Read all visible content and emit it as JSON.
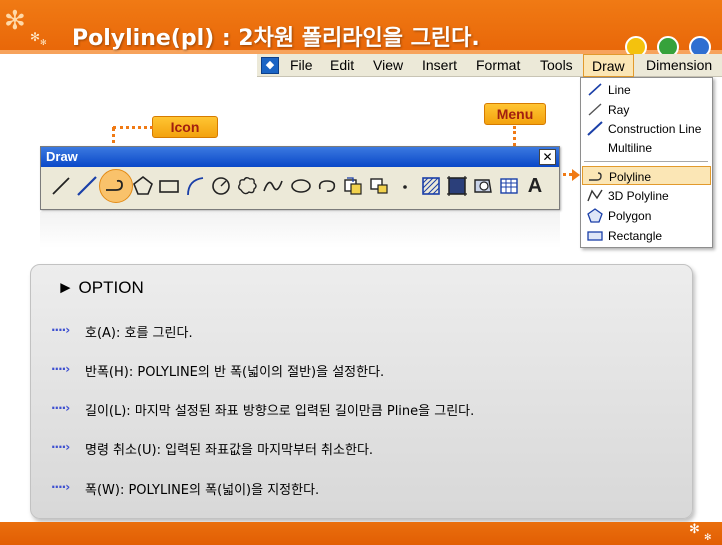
{
  "slide": {
    "title": "Polyline(pl) : 2차원 폴리라인을 그린다."
  },
  "menubar": {
    "items": [
      "File",
      "Edit",
      "View",
      "Insert",
      "Format",
      "Tools",
      "Draw",
      "Dimension"
    ],
    "active": "Draw"
  },
  "dropdown": {
    "items": [
      "Line",
      "Ray",
      "Construction Line",
      "Multiline",
      "Polyline",
      "3D Polyline",
      "Polygon",
      "Rectangle"
    ],
    "selected": "Polyline"
  },
  "callouts": {
    "icon_label": "Icon",
    "menu_label": "Menu"
  },
  "toolbar": {
    "title": "Draw",
    "close": "✕",
    "text_tool": "A",
    "highlighted_icon": "polyline-icon"
  },
  "options": {
    "heading": "► OPTION",
    "bullet": "····›",
    "rows": [
      "호(A): 호를 그린다.",
      "반폭(H): POLYLINE의 반 폭(넓이의 절반)을 설정한다.",
      "길이(L): 마지막 설정된 좌표 방향으로 입력된 길이만큼 Pline을 그린다.",
      "명령 취소(U): 입력된 좌표값을 마지막부터 취소한다.",
      "폭(W): POLYLINE의 폭(넓이)을 지정한다."
    ]
  },
  "colors": {
    "accent": "#f07a14",
    "bullet": "#3d4fd0",
    "callout_text": "#a21f10",
    "toolbar_title": "#0a48c8"
  }
}
